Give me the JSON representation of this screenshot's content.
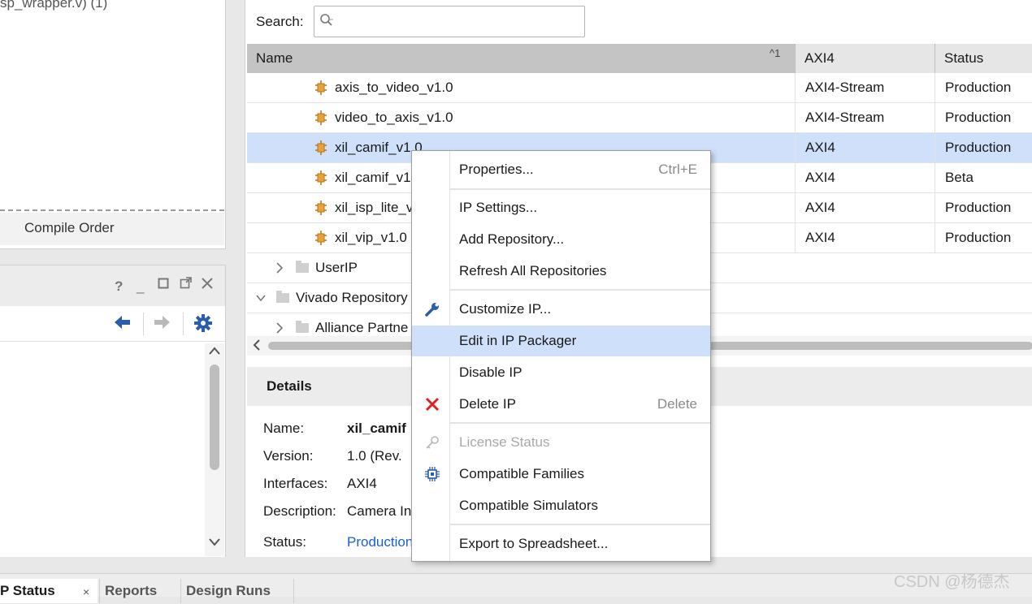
{
  "left_top": {
    "truncated_text": "sp_wrapper.v) (1)",
    "tab_label": "Compile Order"
  },
  "left_bottom": {
    "header_icons": [
      "help-icon",
      "minimize-icon",
      "maximize-icon",
      "float-icon",
      "close-icon"
    ],
    "toolbar_icons": [
      "back-arrow-icon",
      "forward-arrow-icon",
      "gear-icon"
    ]
  },
  "search": {
    "label": "Search:",
    "placeholder": "Q-"
  },
  "table": {
    "columns": {
      "name": "Name",
      "sort_indicator": "^1",
      "axi": "AXI4",
      "status": "Status"
    },
    "ip_rows": [
      {
        "name": "axis_to_video_v1.0",
        "axi": "AXI4-Stream",
        "status": "Production"
      },
      {
        "name": "video_to_axis_v1.0",
        "axi": "AXI4-Stream",
        "status": "Production"
      },
      {
        "name": "xil_camif_v1.0",
        "axi": "AXI4",
        "status": "Production"
      },
      {
        "name": "xil_camif_v1",
        "axi": "AXI4",
        "status": "Beta"
      },
      {
        "name": "xil_isp_lite_v",
        "axi": "AXI4",
        "status": "Production"
      },
      {
        "name": "xil_vip_v1.0",
        "axi": "AXI4",
        "status": "Production"
      }
    ],
    "tree_rows": [
      {
        "label": "UserIP",
        "expanded": false
      },
      {
        "label": "Vivado Repository",
        "expanded": true
      },
      {
        "label": "Alliance Partne",
        "expanded": false
      }
    ]
  },
  "details": {
    "title": "Details",
    "name_key": "Name:",
    "name_val": "xil_camif",
    "version_key": "Version:",
    "version_val": "1.0 (Rev.",
    "interfaces_key": "Interfaces:",
    "interfaces_val": "AXI4",
    "description_key": "Description:",
    "description_val": "Camera In",
    "status_key": "Status:",
    "status_val": "Production"
  },
  "bottom_tabs": [
    "P Status",
    "Reports",
    "Design Runs"
  ],
  "context_menu": {
    "properties": "Properties...",
    "properties_shortcut": "Ctrl+E",
    "ip_settings": "IP Settings...",
    "add_repository": "Add Repository...",
    "refresh_all": "Refresh All Repositories",
    "customize_ip": "Customize IP...",
    "edit_in_packager": "Edit in IP Packager",
    "disable_ip": "Disable IP",
    "delete_ip": "Delete IP",
    "delete_shortcut": "Delete",
    "license_status": "License Status",
    "compatible_families": "Compatible Families",
    "compatible_simulators": "Compatible Simulators",
    "export_spreadsheet": "Export to Spreadsheet..."
  },
  "watermark": "CSDN @杨德杰",
  "colors": {
    "selection": "#cfe0fb",
    "link": "#1a5fd6",
    "delete_red": "#e02020",
    "toolbar_blue": "#2a5ea8"
  }
}
